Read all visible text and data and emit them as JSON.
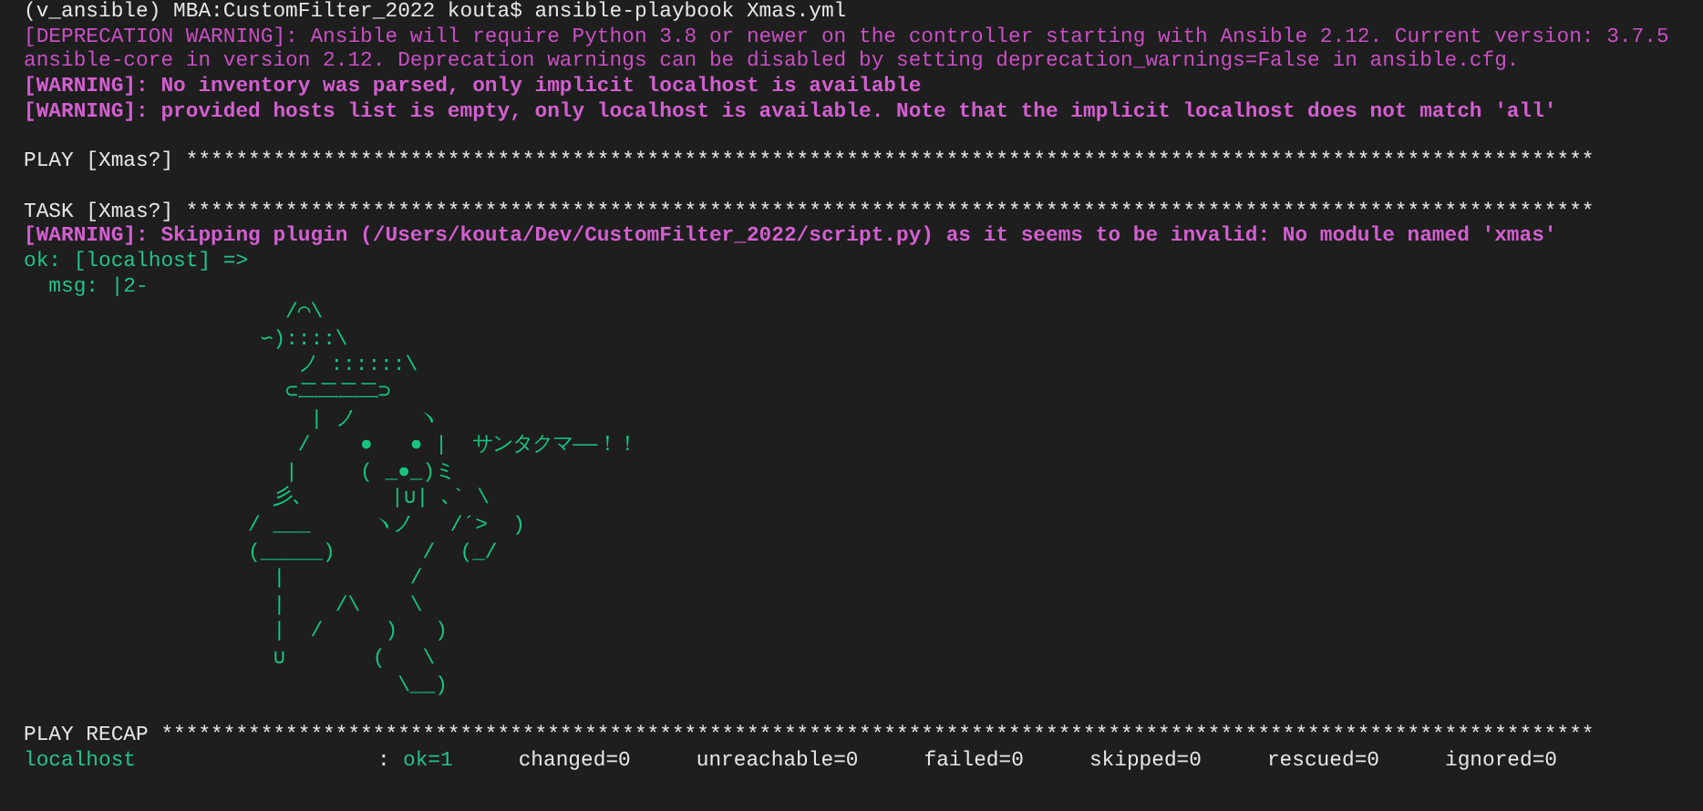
{
  "lines": [
    {
      "kind": "prompt",
      "text": "(v_ansible) MBA:CustomFilter_2022 kouta$ ansible-playbook Xmas.yml"
    },
    {
      "kind": "deprecation",
      "text": "[DEPRECATION WARNING]: Ansible will require Python 3.8 or newer on the controller starting with Ansible 2.12. Current version: 3.7.5"
    },
    {
      "kind": "deprecation",
      "text": "ansible-core in version 2.12. Deprecation warnings can be disabled by setting deprecation_warnings=False in ansible.cfg."
    },
    {
      "kind": "warning",
      "text": "[WARNING]: No inventory was parsed, only implicit localhost is available"
    },
    {
      "kind": "warning",
      "text": "[WARNING]: provided hosts list is empty, only localhost is available. Note that the implicit localhost does not match 'all'"
    },
    {
      "kind": "blank"
    },
    {
      "kind": "header",
      "text": "PLAY [Xmas?] *****************************************************************************************************************"
    },
    {
      "kind": "blank"
    },
    {
      "kind": "header",
      "text": "TASK [Xmas?] *****************************************************************************************************************"
    },
    {
      "kind": "warning",
      "text": "[WARNING]: Skipping plugin (/Users/kouta/Dev/CustomFilter_2022/script.py) as it seems to be invalid: No module named 'xmas'"
    },
    {
      "kind": "ok",
      "text": "ok: [localhost] =>"
    },
    {
      "kind": "ok",
      "text": "  msg: |2-"
    },
    {
      "kind": "art",
      "text": "                     /⌒\\"
    },
    {
      "kind": "art",
      "text": "                   ∽)::::\\"
    },
    {
      "kind": "art",
      "text": "                      ノ ::::::\\"
    },
    {
      "kind": "art",
      "text": "                     ⊂二二二二⊃"
    },
    {
      "kind": "art",
      "text": "                       | ノ     ヽ"
    },
    {
      "kind": "art",
      "text": "                      /    ●   ● |  サンタクマ――！！"
    },
    {
      "kind": "art",
      "text": "                     |     ( _●_)ミ"
    },
    {
      "kind": "art",
      "text": "                    彡､       |∪| ､` \\"
    },
    {
      "kind": "art",
      "text": "                  / ___     ヽノ   /´>  )"
    },
    {
      "kind": "art",
      "text": "                  (_____)       /  (_/"
    },
    {
      "kind": "art",
      "text": "                    |          /"
    },
    {
      "kind": "art",
      "text": "                    |    /\\    \\"
    },
    {
      "kind": "art",
      "text": "                    |  /     )   )"
    },
    {
      "kind": "art",
      "text": "                    ∪       (   \\"
    },
    {
      "kind": "art",
      "text": "                              \\__)"
    },
    {
      "kind": "blank"
    },
    {
      "kind": "header",
      "text": "PLAY RECAP *******************************************************************************************************************"
    }
  ],
  "recap": {
    "host": "localhost",
    "separator": ":",
    "stats": [
      {
        "kind": "ok",
        "text": "ok=1"
      },
      {
        "kind": "plain",
        "text": "changed=0"
      },
      {
        "kind": "plain",
        "text": "unreachable=0"
      },
      {
        "kind": "plain",
        "text": "failed=0"
      },
      {
        "kind": "plain",
        "text": "skipped=0"
      },
      {
        "kind": "plain",
        "text": "rescued=0"
      },
      {
        "kind": "plain",
        "text": "ignored=0"
      }
    ]
  }
}
